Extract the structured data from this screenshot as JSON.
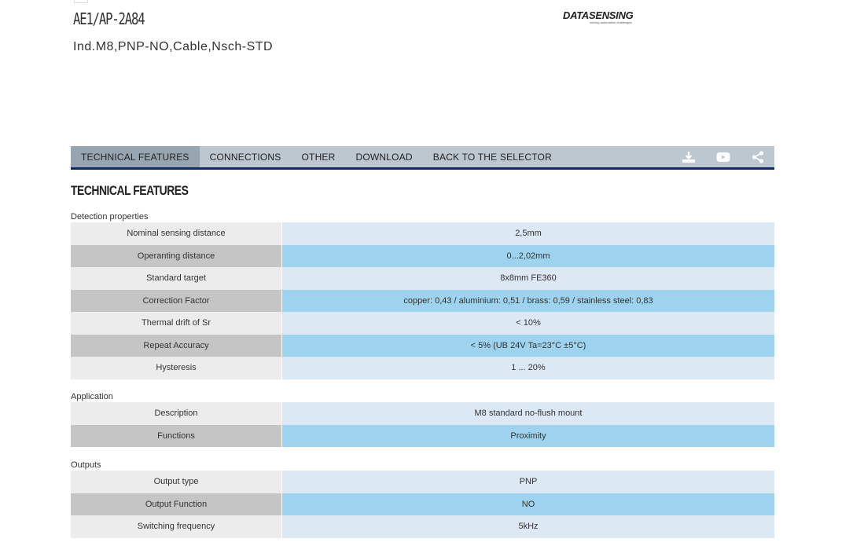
{
  "header": {
    "product_code": "AE1/AP-2A84",
    "product_description": "Ind.M8,PNP-NO,Cable,Nsch-STD",
    "logo_text": "DATASENSING",
    "logo_tagline": "solving automation challenges"
  },
  "nav": {
    "tabs": [
      {
        "label": "TECHNICAL FEATURES",
        "active": true
      },
      {
        "label": "CONNECTIONS",
        "active": false
      },
      {
        "label": "OTHER",
        "active": false
      },
      {
        "label": "DOWNLOAD",
        "active": false
      },
      {
        "label": "BACK TO THE SELECTOR",
        "active": false
      }
    ],
    "icons": [
      "download-icon",
      "youtube-icon",
      "share-icon"
    ]
  },
  "main": {
    "title": "TECHNICAL FEATURES",
    "groups": [
      {
        "label": "Detection properties",
        "rows": [
          {
            "label": "Nominal sensing distance",
            "value": "2,5mm"
          },
          {
            "label": "Operanting distance",
            "value": "0...2,02mm"
          },
          {
            "label": "Standard target",
            "value": "8x8mm FE360"
          },
          {
            "label": "Correction Factor",
            "value": "copper: 0,43 / aluminium: 0,51 / brass: 0,59 / stainless steel: 0,83"
          },
          {
            "label": "Thermal drift of Sr",
            "value": "< 10%"
          },
          {
            "label": "Repeat Accuracy",
            "value": "< 5% (UB 24V Ta=23°C ±5°C)"
          },
          {
            "label": "Hysteresis",
            "value": "1 ... 20%"
          }
        ]
      },
      {
        "label": "Application",
        "rows": [
          {
            "label": "Description",
            "value": "M8 standard no-flush mount"
          },
          {
            "label": "Functions",
            "value": "Proximity"
          }
        ]
      },
      {
        "label": "Outputs",
        "rows": [
          {
            "label": "Output type",
            "value": "PNP"
          },
          {
            "label": "Output Function",
            "value": "NO"
          },
          {
            "label": "Switching frequency",
            "value": "5kHz"
          }
        ]
      }
    ]
  },
  "colors": {
    "nav_border": "#0f2a6b",
    "nav_bg": "#bcc7d0",
    "nav_active_bg": "#97a5b1",
    "row_highlight": "#9dd3ee",
    "row_light": "#dce8f4"
  }
}
